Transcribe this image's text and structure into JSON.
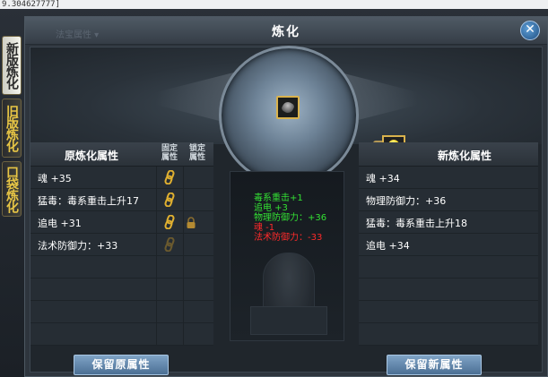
{
  "top_strip_text": "9.304627777]",
  "side_tabs": [
    {
      "label": "新版炼化",
      "active": true
    },
    {
      "label": "旧版炼化",
      "active": false
    },
    {
      "label": "口袋炼化",
      "active": false
    }
  ],
  "window": {
    "title": "炼化",
    "ghost_text": "法宝属性 ▾"
  },
  "left_panel": {
    "title": "原炼化属性",
    "col_fixed": "固定属性",
    "col_lock": "锁定属性",
    "rows": [
      {
        "text": "魂 +35",
        "fixed_active": true,
        "locked": false
      },
      {
        "text": "猛毒：毒系重击上升17",
        "fixed_active": true,
        "locked": false
      },
      {
        "text": "追电 +31",
        "fixed_active": true,
        "locked": true
      },
      {
        "text": "法术防御力：+33",
        "fixed_active": false,
        "locked": false
      },
      {
        "text": "",
        "fixed_active": false,
        "locked": false
      },
      {
        "text": "",
        "fixed_active": false,
        "locked": false
      },
      {
        "text": "",
        "fixed_active": false,
        "locked": false
      },
      {
        "text": "",
        "fixed_active": false,
        "locked": false
      }
    ]
  },
  "middle_panel": {
    "changes": [
      {
        "text": "毒系重击+1",
        "color": "#33e033"
      },
      {
        "text": "追电 +3",
        "color": "#33e033"
      },
      {
        "text": "物理防御力：+36",
        "color": "#33e033"
      },
      {
        "text": "魂 -1",
        "color": "#ff2a2a"
      },
      {
        "text": "法术防御力：-33",
        "color": "#ff2a2a"
      }
    ]
  },
  "right_panel": {
    "title": "新炼化属性",
    "rows": [
      {
        "text": "魂 +34"
      },
      {
        "text": "物理防御力：+36"
      },
      {
        "text": "猛毒：毒系重击上升18"
      },
      {
        "text": "追电 +34"
      },
      {
        "text": ""
      },
      {
        "text": ""
      },
      {
        "text": ""
      },
      {
        "text": ""
      }
    ]
  },
  "buttons": {
    "keep_old": "保留原属性",
    "keep_new": "保留新属性"
  },
  "icons": {
    "item_slot": "gem-item-icon",
    "bulb": "lightbulb-icon",
    "chain": "chain-link-icon",
    "lock": "lock-icon",
    "close": "close-icon"
  },
  "colors": {
    "accent_gold": "#d9b24c",
    "gain_green": "#33e033",
    "loss_red": "#ff2a2a"
  }
}
